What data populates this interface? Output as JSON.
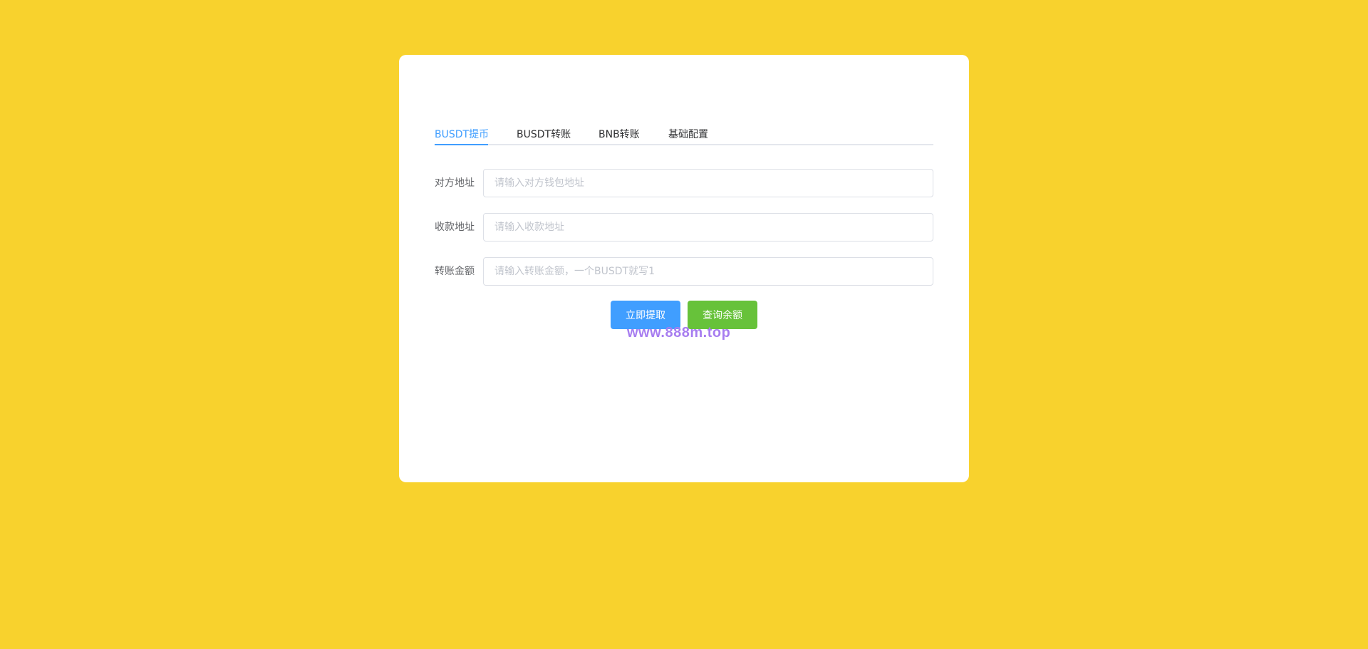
{
  "tabs": [
    {
      "label": "BUSDT提币",
      "active": true
    },
    {
      "label": "BUSDT转账",
      "active": false
    },
    {
      "label": "BNB转账",
      "active": false
    },
    {
      "label": "基础配置",
      "active": false
    }
  ],
  "form": {
    "fields": [
      {
        "label": "对方地址",
        "placeholder": "请输入对方钱包地址",
        "value": ""
      },
      {
        "label": "收款地址",
        "placeholder": "请输入收款地址",
        "value": ""
      },
      {
        "label": "转账金额",
        "placeholder": "请输入转账金额，一个BUSDT就写1",
        "value": ""
      }
    ]
  },
  "buttons": {
    "withdraw_label": "立即提取",
    "balance_label": "查询余额"
  },
  "watermark": "www.888m.top",
  "colors": {
    "page_background": "#f8d22d",
    "card_background": "#ffffff",
    "accent": "#409eff",
    "success": "#67c23a",
    "watermark": "#a77df0"
  }
}
